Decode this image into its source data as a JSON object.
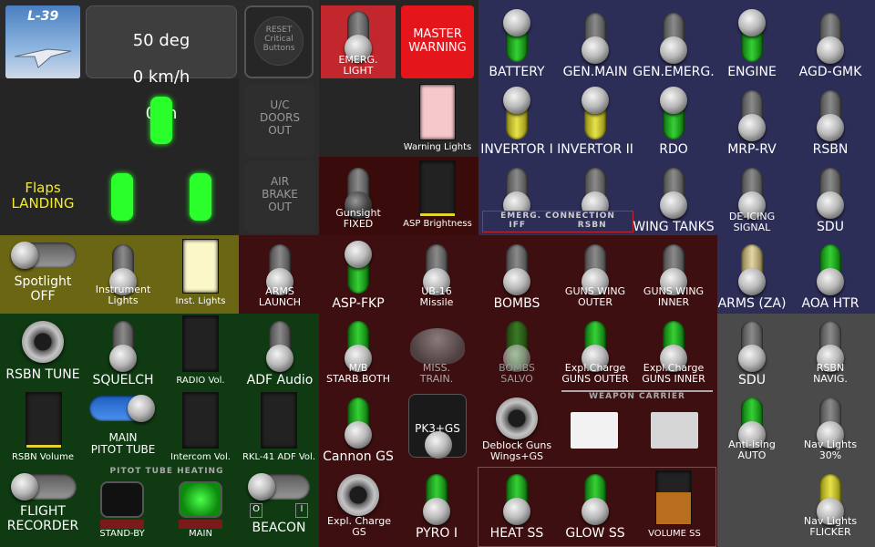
{
  "app": {
    "logo_text": "L-39"
  },
  "readout": {
    "line1": "50 deg",
    "line2": "0 km/h",
    "line3": "0 m"
  },
  "reset": {
    "label": "RESET\nCritical\nButtons"
  },
  "emerg_light": {
    "label": "EMERG.\nLIGHT"
  },
  "master_warning": {
    "label": "MASTER\nWARNING"
  },
  "warning_lights": {
    "label": "Warning Lights"
  },
  "uc_doors": {
    "label": "U/C\nDOORS\nOUT"
  },
  "air_brake": {
    "label": "AIR\nBRAKE\nOUT"
  },
  "flaps": {
    "label": "Flaps\nLANDING"
  },
  "gunsight": {
    "label": "Gunsight\nFIXED"
  },
  "asp_brightness": {
    "label": "ASP Brightness"
  },
  "power": {
    "row1": [
      "BATTERY",
      "GEN.MAIN",
      "GEN.EMERG.",
      "ENGINE",
      "AGD-GMK"
    ],
    "row2": [
      "INVERTOR I",
      "INVERTOR II",
      "RDO",
      "MRP-RV",
      "RSBN"
    ],
    "row3": [
      "WING TANKS",
      "DE-ICING\nSIGNAL",
      "SDU"
    ],
    "emerg_conn": {
      "title": "EMERG. CONNECTION",
      "left": "IFF",
      "right": "RSBN"
    }
  },
  "lights": {
    "spotlight": "Spotlight\nOFF",
    "instrument_lights": "Instrument\nLights",
    "inst_lights": "Inst. Lights"
  },
  "arms": {
    "arms_launch": "ARMS\nLAUNCH",
    "asp_fkp": "ASP-FKP",
    "ub16": "UB-16\nMissile",
    "bombs": "BOMBS",
    "guns_wing_outer": "GUNS WING\nOUTER",
    "guns_wing_inner": "GUNS WING\nINNER",
    "arms_za": "ARMS (ZA)",
    "aoa_htr": "AOA HTR",
    "mb": "M/B\nSTARB.BOTH",
    "miss_train": "MISS.\nTRAIN.",
    "bombs_salvo": "BOMBS\nSALVO",
    "expl_guns_outer": "Expl.Charge\nGUNS OUTER",
    "expl_guns_inner": "Expl.Charge\nGUNS INNER",
    "cannon_gs": "Cannon GS",
    "pk3": "PK3+GS",
    "deblock": "Deblock Guns\nWings+GS",
    "weapon_carrier": "WEAPON CARRIER",
    "expl_gs": "Expl. Charge\nGS",
    "pyro": "PYRO I",
    "heat_ss": "HEAT SS",
    "glow_ss": "GLOW SS",
    "volume_ss": "VOLUME SS"
  },
  "radio": {
    "rsbn_tune": "RSBN TUNE",
    "squelch": "SQUELCH",
    "radio_vol": "RADIO Vol.",
    "adf_audio": "ADF Audio",
    "rsbn_volume": "RSBN Volume",
    "main_pitot": "MAIN\nPITOT TUBE",
    "intercom_vol": "Intercom Vol.",
    "rkl_vol": "RKL-41 ADF Vol.",
    "flight_recorder": "FLIGHT\nRECORDER",
    "pitot_heating": "PITOT TUBE HEATING",
    "standby": "STAND-BY",
    "main": "MAIN",
    "beacon": "BEACON",
    "beacon_off": "O",
    "beacon_on": "I"
  },
  "right": {
    "sdu": "SDU",
    "rsbn_navig": "RSBN\nNAVIG.",
    "anti_ising": "Anti-ising\nAUTO",
    "nav_lights": "Nav Lights\n30%",
    "nav_flicker": "Nav Lights\nFLICKER"
  },
  "colors": {
    "warning_red": "#e4161c",
    "light_green": "#2bff2b",
    "flaps_yellow": "#f4ee2a"
  }
}
